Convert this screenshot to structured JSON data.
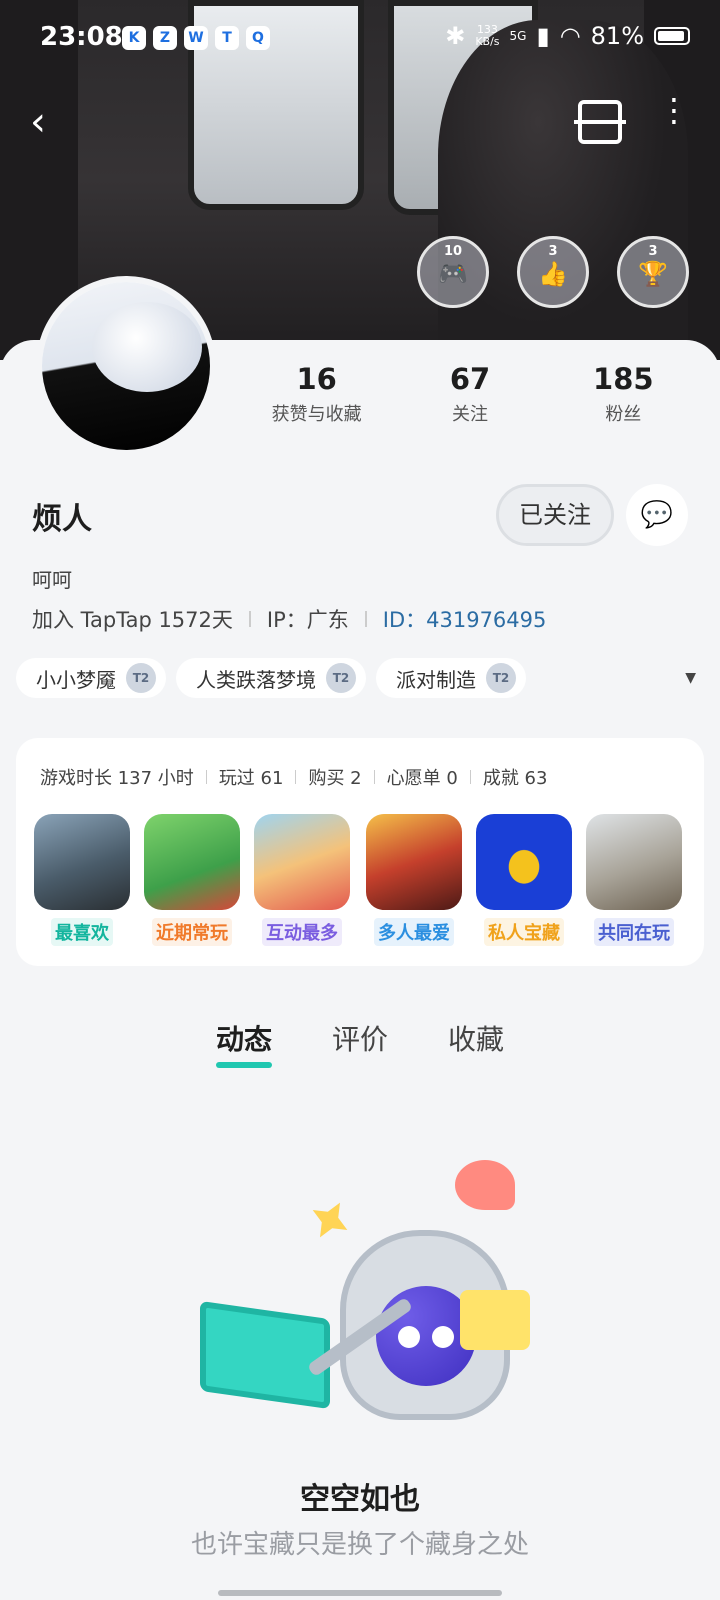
{
  "status_bar": {
    "time": "23:08",
    "apps": [
      "K",
      "Z",
      "W",
      "T",
      "Q"
    ],
    "speed_value": "133",
    "speed_unit": "KB/s",
    "network": "5G",
    "battery": "81%"
  },
  "header": {
    "badges": [
      {
        "num": "10",
        "icon": "gamepad-icon"
      },
      {
        "num": "3",
        "icon": "thumbs-up-icon"
      },
      {
        "num": "3",
        "icon": "trophy-icon"
      }
    ]
  },
  "stats": [
    {
      "value": "16",
      "label": "获赞与收藏"
    },
    {
      "value": "67",
      "label": "关注"
    },
    {
      "value": "185",
      "label": "粉丝"
    }
  ],
  "profile": {
    "name": "烦人",
    "follow_label": "已关注",
    "bio": "呵呵",
    "joined": "加入 TapTap 1572天",
    "ip": "IP：广东",
    "id": "ID：431976495"
  },
  "tags": [
    {
      "label": "小小梦魇",
      "badge": "T2"
    },
    {
      "label": "人类跌落梦境",
      "badge": "T2"
    },
    {
      "label": "派对制造",
      "badge": "T2"
    }
  ],
  "game_stats": [
    "游戏时长 137 小时",
    "玩过 61",
    "购买 2",
    "心愿单 0",
    "成就 63"
  ],
  "games": [
    {
      "label": "最喜欢",
      "color": "#13b59e",
      "bg": "#e6f8f5"
    },
    {
      "label": "近期常玩",
      "color": "#f07a2b",
      "bg": "#fdf1e6"
    },
    {
      "label": "互动最多",
      "color": "#7a5de0",
      "bg": "#efebfb"
    },
    {
      "label": "多人最爱",
      "color": "#2b8fe0",
      "bg": "#e6f2fc"
    },
    {
      "label": "私人宝藏",
      "color": "#f0a21b",
      "bg": "#fdf4e2"
    },
    {
      "label": "共同在玩",
      "color": "#4a5fd0",
      "bg": "#e9ecfb"
    }
  ],
  "tabs": [
    {
      "label": "动态",
      "active": true
    },
    {
      "label": "评价",
      "active": false
    },
    {
      "label": "收藏",
      "active": false
    }
  ],
  "empty": {
    "title": "空空如也",
    "subtitle": "也许宝藏只是换了个藏身之处"
  }
}
